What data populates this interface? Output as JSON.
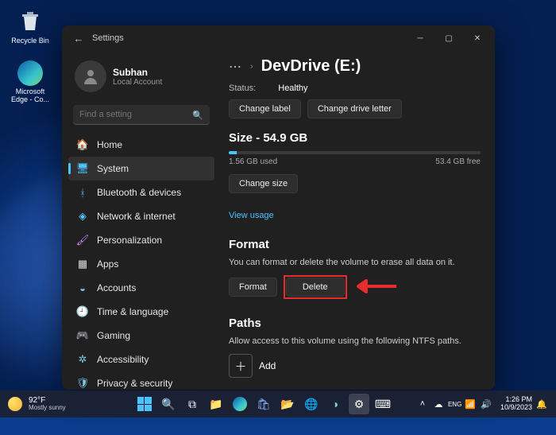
{
  "desktop": {
    "recycle_label": "Recycle Bin",
    "edge_label": "Microsoft Edge - Co..."
  },
  "window": {
    "title": "Settings",
    "user": {
      "name": "Subhan",
      "sub": "Local Account"
    },
    "search_placeholder": "Find a setting",
    "nav": [
      {
        "key": "home",
        "label": "Home",
        "icon": "🏠",
        "color": "#ddd"
      },
      {
        "key": "system",
        "label": "System",
        "icon": "🖥",
        "color": "#4cc2ff"
      },
      {
        "key": "bluetooth",
        "label": "Bluetooth & devices",
        "icon": "ᚼ",
        "color": "#5aa0ff"
      },
      {
        "key": "network",
        "label": "Network & internet",
        "icon": "◈",
        "color": "#4cc2ff"
      },
      {
        "key": "personalization",
        "label": "Personalization",
        "icon": "🖌",
        "color": "#d28bff"
      },
      {
        "key": "apps",
        "label": "Apps",
        "icon": "▦",
        "color": "#ddd"
      },
      {
        "key": "accounts",
        "label": "Accounts",
        "icon": "◒",
        "color": "#8ab4ff"
      },
      {
        "key": "time",
        "label": "Time & language",
        "icon": "🕘",
        "color": "#ddd"
      },
      {
        "key": "gaming",
        "label": "Gaming",
        "icon": "🎮",
        "color": "#9aa0ff"
      },
      {
        "key": "accessibility",
        "label": "Accessibility",
        "icon": "✲",
        "color": "#7cc9e8"
      },
      {
        "key": "privacy",
        "label": "Privacy & security",
        "icon": "🛡",
        "color": "#7cc9e8"
      }
    ],
    "active_nav": "system"
  },
  "page": {
    "heading": "DevDrive (E:)",
    "status_label": "Status:",
    "status_value": "Healthy",
    "change_label": "Change label",
    "change_letter": "Change drive letter",
    "size_heading": "Size - 54.9 GB",
    "used": "1.56 GB used",
    "free": "53.4 GB free",
    "change_size": "Change size",
    "view_usage": "View usage",
    "format_heading": "Format",
    "format_desc": "You can format or delete the volume to erase all data on it.",
    "format_btn": "Format",
    "delete_btn": "Delete",
    "paths_heading": "Paths",
    "paths_desc": "Allow access to this volume using the following NTFS paths.",
    "add_label": "Add"
  },
  "taskbar": {
    "temp": "92°F",
    "weather": "Mostly sunny",
    "time": "1:26 PM",
    "date": "10/9/2023"
  }
}
